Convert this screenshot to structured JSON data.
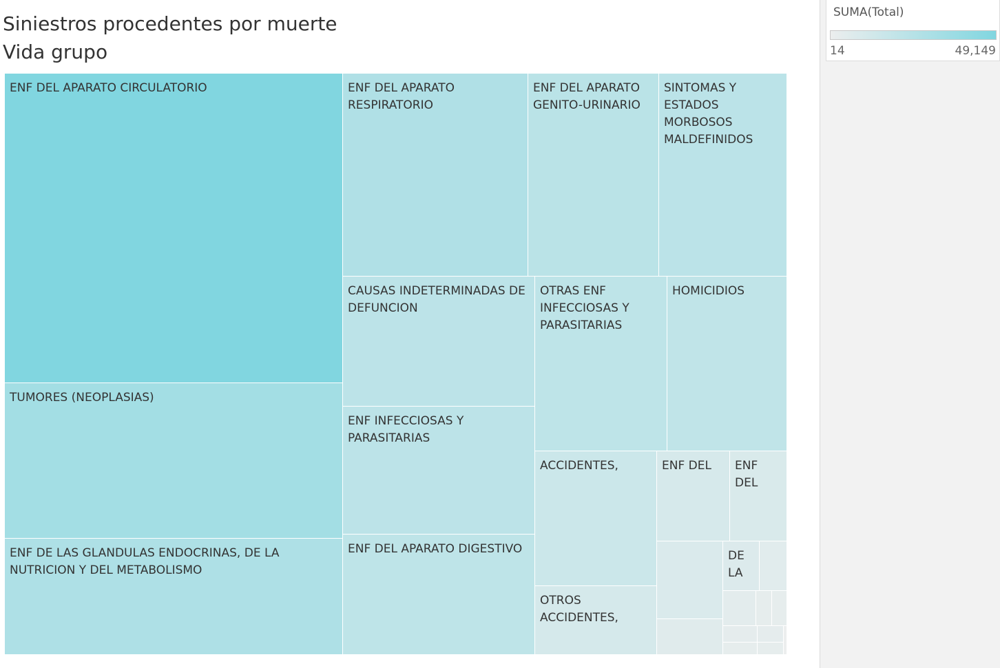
{
  "title": {
    "line1": "Siniestros procedentes por muerte",
    "line2": "Vida grupo"
  },
  "legend": {
    "title": "SUMA(Total)",
    "min_label": "14",
    "max_label": "49,149",
    "color_low": "#eceeee",
    "color_high": "#81d6e0"
  },
  "chart_data": {
    "type": "treemap",
    "measure": "SUMA(Total)",
    "range": [
      14,
      49149
    ],
    "items": [
      {
        "label": "ENF DEL APARATO CIRCULATORIO",
        "value": 49149
      },
      {
        "label": "TUMORES (NEOPLASIAS)",
        "value": 24500
      },
      {
        "label": "ENF DE LAS GLANDULAS ENDOCRINAS, DE  LA NUTRICION Y DEL METABOLISMO",
        "value": 18300
      },
      {
        "label": "ENF DEL APARATO RESPIRATORIO",
        "value": 17400
      },
      {
        "label": "ENF DEL APARATO GENITO-URINARIO",
        "value": 12300
      },
      {
        "label": "SINTOMAS Y ESTADOS MORBOSOS MALDEFINIDOS",
        "value": 11800
      },
      {
        "label": "CAUSAS INDETERMINADAS DE DEFUNCION",
        "value": 11600
      },
      {
        "label": "ENF INFECCIOSAS Y PARASITARIAS",
        "value": 11400
      },
      {
        "label": "ENF DEL APARATO DIGESTIVO",
        "value": 10700
      },
      {
        "label": "OTRAS ENF INFECCIOSAS Y PARASITARIAS",
        "value": 10400
      },
      {
        "label": "HOMICIDIOS",
        "value": 9800
      },
      {
        "label": "ACCIDENTES,",
        "value": 5800
      },
      {
        "label": "OTROS ACCIDENTES,",
        "value": 3000
      },
      {
        "label": "ENF DEL",
        "value": 2800
      },
      {
        "label": "ENF DEL",
        "value": 2200
      },
      {
        "label": "",
        "value": 2000
      },
      {
        "label": "",
        "value": 1000
      },
      {
        "label": "DE LA",
        "value": 1500
      },
      {
        "label": "",
        "value": 800
      },
      {
        "label": "",
        "value": 600
      },
      {
        "label": "",
        "value": 250
      },
      {
        "label": "",
        "value": 250
      },
      {
        "label": "",
        "value": 400
      },
      {
        "label": "",
        "value": 400
      },
      {
        "label": "",
        "value": 300
      },
      {
        "label": "",
        "value": 300
      },
      {
        "label": "",
        "value": 14
      }
    ]
  }
}
